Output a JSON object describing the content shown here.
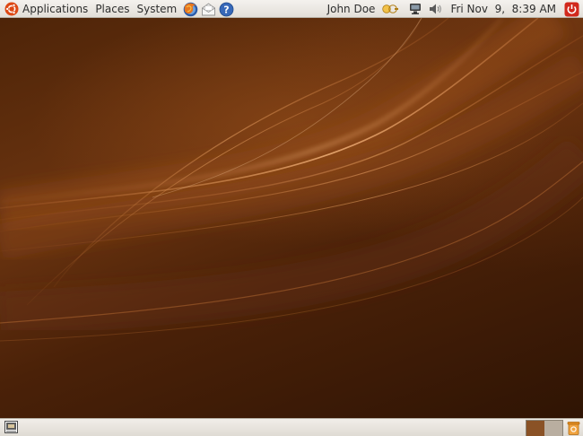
{
  "top_panel": {
    "menus": [
      {
        "label": "Applications",
        "icon": "ubuntu-logo-icon"
      },
      {
        "label": "Places"
      },
      {
        "label": "System"
      }
    ],
    "launchers": [
      {
        "name": "firefox-launcher",
        "icon": "firefox-icon"
      },
      {
        "name": "mail-launcher",
        "icon": "mail-icon"
      },
      {
        "name": "help-launcher",
        "icon": "help-icon"
      }
    ],
    "user_name": "John Doe",
    "datetime": "Fri Nov  9,  8:39 AM",
    "tray_icons": [
      "switch-user-icon",
      "network-icon",
      "volume-icon",
      "power-icon"
    ]
  },
  "bottom_panel": {
    "workspaces": [
      {
        "id": 1,
        "active": true,
        "color": "#8a5226"
      },
      {
        "id": 2,
        "active": false,
        "color": "#b9aea0"
      }
    ],
    "icons": [
      "show-desktop-icon",
      "trash-icon"
    ]
  },
  "colors": {
    "panel_bg": "#ece9e3",
    "desktop_base": "#4e2408",
    "accent_orange": "#dd4814",
    "power_red": "#cc2a1e"
  }
}
